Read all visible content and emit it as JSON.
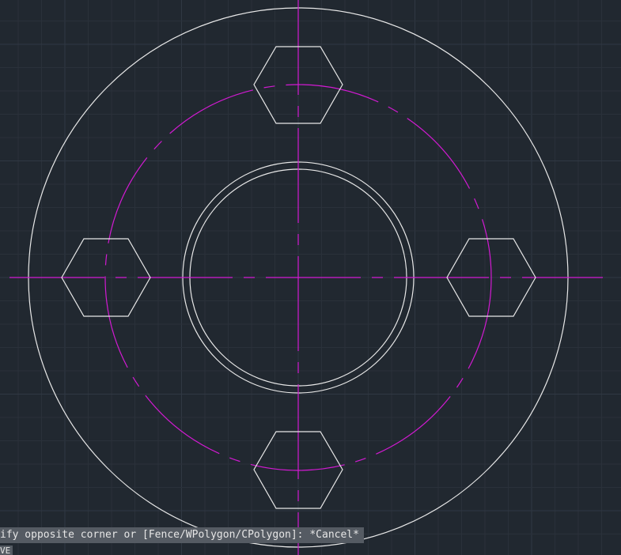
{
  "canvas": {
    "background": "#212830",
    "grid_minor_color": "#2a313a",
    "grid_major_color": "#303843",
    "object_color": "#e8e8e8",
    "centerline_color": "#d21ad2"
  },
  "command_line": {
    "history_text": "ify opposite corner or [Fence/WPolygon/CPolygon]: *Cancel*",
    "prompt_text": "VE"
  }
}
